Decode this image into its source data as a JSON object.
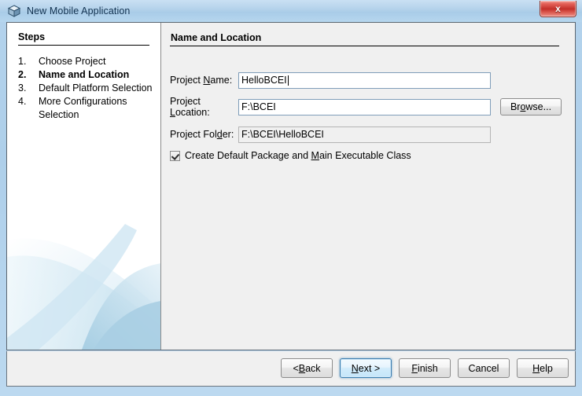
{
  "window": {
    "title": "New Mobile Application",
    "icon": "cube-icon",
    "close_label": "x",
    "titlebar_color": "#aecfea",
    "frame_color": "#5c6670"
  },
  "steps": {
    "heading": "Steps",
    "items": [
      {
        "num": "1.",
        "label": "Choose Project",
        "current": false
      },
      {
        "num": "2.",
        "label": "Name and Location",
        "current": true
      },
      {
        "num": "3.",
        "label": "Default Platform Selection",
        "current": false
      },
      {
        "num": "4.",
        "label": "More Configurations Selection",
        "current": false
      }
    ]
  },
  "form": {
    "title": "Name and Location",
    "fields": [
      {
        "label_pre": "Project ",
        "label_mnemonic": "N",
        "label_post": "ame:",
        "value": "HelloBCEI",
        "readonly": false,
        "focused": true
      },
      {
        "label_pre": "Project ",
        "label_mnemonic": "L",
        "label_post": "ocation:",
        "value": "F:\\BCEI",
        "readonly": false,
        "focused": false
      },
      {
        "label_pre": "Project Fol",
        "label_mnemonic": "d",
        "label_post": "er:",
        "value": "F:\\BCEI\\HelloBCEI",
        "readonly": true,
        "focused": false
      }
    ],
    "browse_button": {
      "pre": "Br",
      "mnemonic": "o",
      "post": "wse..."
    },
    "checkbox": {
      "checked": true,
      "pre": "Create Default Package and ",
      "mnemonic": "M",
      "post": "ain Executable Class"
    }
  },
  "buttons": [
    {
      "pre": "< ",
      "mnemonic": "B",
      "post": "ack",
      "focused": false,
      "name": "back-button"
    },
    {
      "pre": "",
      "mnemonic": "N",
      "post": "ext >",
      "focused": true,
      "name": "next-button"
    },
    {
      "pre": "",
      "mnemonic": "F",
      "post": "inish",
      "focused": false,
      "name": "finish-button"
    },
    {
      "pre": "",
      "mnemonic": "",
      "post": "Cancel",
      "focused": false,
      "name": "cancel-button"
    },
    {
      "pre": "",
      "mnemonic": "H",
      "post": "elp",
      "focused": false,
      "name": "help-button"
    }
  ]
}
